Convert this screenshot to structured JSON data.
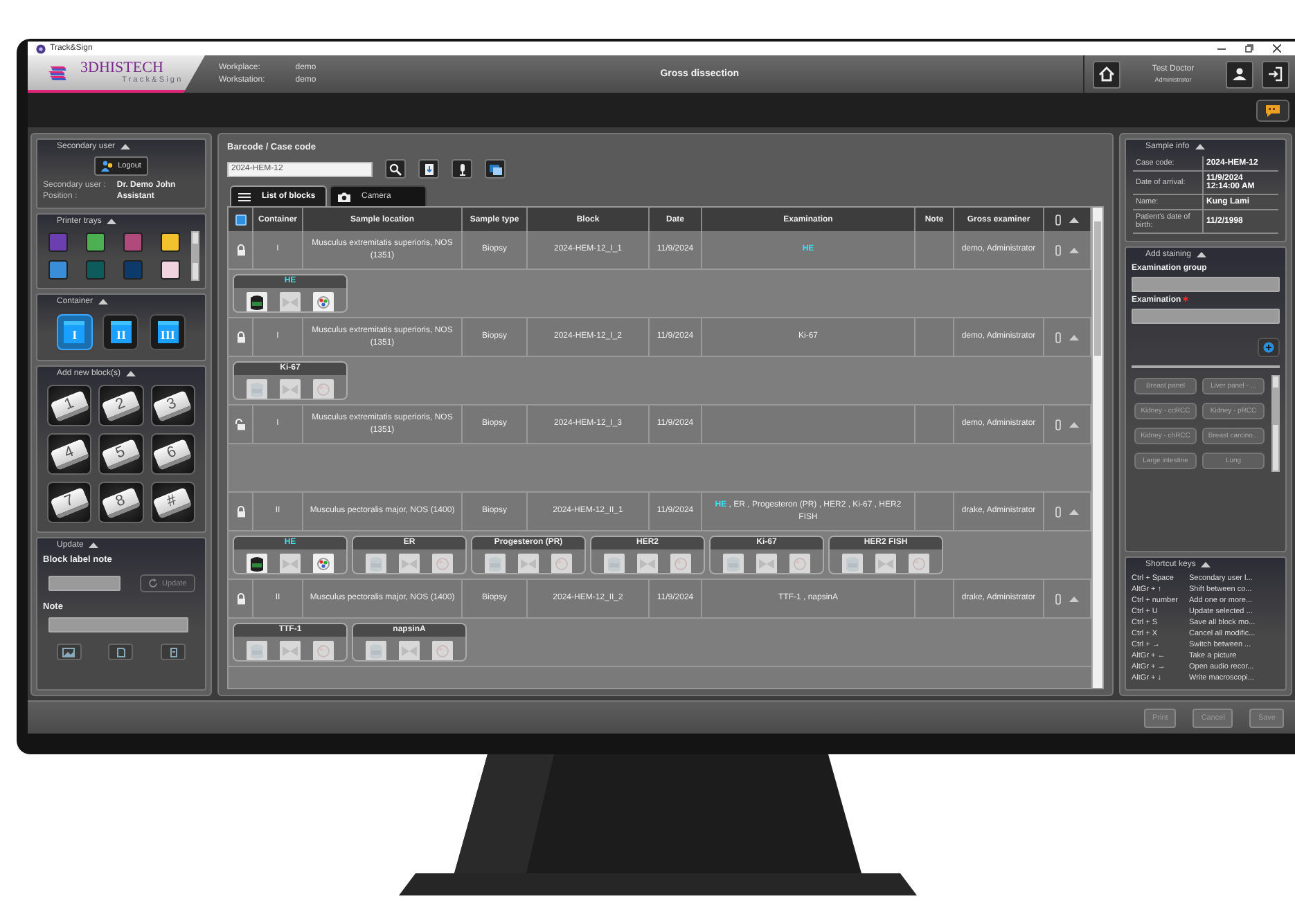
{
  "window": {
    "title": "Track&Sign"
  },
  "header": {
    "logo_name": "3DHISTECH",
    "logo_product": "Track&Sign",
    "info": [
      {
        "label": "Workplace:",
        "value": "demo"
      },
      {
        "label": "Workstation:",
        "value": "demo"
      }
    ],
    "module": "Gross dissection",
    "user": {
      "name": "Test Doctor",
      "role": "Administrator"
    }
  },
  "secondary_user": {
    "title": "Secondary user",
    "logout": "Logout",
    "fields": [
      {
        "label": "Secondary user :",
        "value": "Dr. Demo John"
      },
      {
        "label": "Position :",
        "value": "Assistant"
      }
    ]
  },
  "printer_trays": {
    "title": "Printer trays",
    "trays": [
      {
        "color": "#6b3fb0"
      },
      {
        "color": "#4caf50"
      },
      {
        "color": "#b04a7c"
      },
      {
        "color": "#f2c12e"
      },
      {
        "color": "#3a8ed8"
      },
      {
        "color": "#0e5b5b"
      },
      {
        "color": "#0c3a6b"
      },
      {
        "color": "#f1d3e0"
      }
    ]
  },
  "container": {
    "title": "Container",
    "options": [
      {
        "label": "I",
        "selected": true
      },
      {
        "label": "II",
        "selected": false
      },
      {
        "label": "III",
        "selected": false
      }
    ]
  },
  "add_blocks": {
    "title": "Add new block(s)",
    "keys": [
      "1",
      "2",
      "3",
      "4",
      "5",
      "6",
      "7",
      "8",
      "#"
    ]
  },
  "update": {
    "title": "Update",
    "block_label_note": "Block label note",
    "update_button": "Update",
    "update_disabled": true,
    "note": "Note"
  },
  "search": {
    "label": "Barcode / Case code",
    "value": "2024-HEM-12"
  },
  "tabs": [
    {
      "label": "List of blocks",
      "selected": true,
      "kind": "list"
    },
    {
      "label": "Camera",
      "selected": false,
      "kind": "camera"
    }
  ],
  "table": {
    "select_all_checked": true,
    "columns": [
      "Container",
      "Sample location",
      "Sample type",
      "Block",
      "Date",
      "Examination",
      "Note",
      "Gross examiner"
    ],
    "rows": [
      {
        "locked": true,
        "container": "I",
        "location": "Musculus extremitatis superioris, NOS (1351)",
        "type": "Biopsy",
        "block": "2024-HEM-12_I_1",
        "date": "11/9/2024",
        "examination": [
          {
            "text": "HE",
            "highlighted": true
          }
        ],
        "examiner": "demo, Administrator",
        "stainings": [
          {
            "name": "HE",
            "active": true
          }
        ]
      },
      {
        "locked": true,
        "container": "I",
        "location": "Musculus extremitatis superioris, NOS (1351)",
        "type": "Biopsy",
        "block": "2024-HEM-12_I_2",
        "date": "11/9/2024",
        "examination": [
          {
            "text": "Ki-67",
            "highlighted": false
          }
        ],
        "examiner": "demo, Administrator",
        "stainings": [
          {
            "name": "Ki-67",
            "active": false
          }
        ]
      },
      {
        "locked": false,
        "container": "I",
        "location": "Musculus extremitatis superioris, NOS (1351)",
        "type": "Biopsy",
        "block": "2024-HEM-12_I_3",
        "date": "11/9/2024",
        "examination": [],
        "examiner": "demo, Administrator",
        "stainings": []
      },
      {
        "locked": true,
        "container": "II",
        "location": "Musculus pectoralis major, NOS (1400)",
        "type": "Biopsy",
        "block": "2024-HEM-12_II_1",
        "date": "11/9/2024",
        "examination": [
          {
            "text": "HE",
            "highlighted": true
          },
          {
            "text": " , ER , Progesteron (PR) , HER2 , Ki-67 , HER2 FISH",
            "highlighted": false
          }
        ],
        "examiner": "drake, Administrator",
        "stainings": [
          {
            "name": "HE",
            "active": true
          },
          {
            "name": "ER",
            "active": false
          },
          {
            "name": "Progesteron (PR)",
            "active": false
          },
          {
            "name": "HER2",
            "active": false
          },
          {
            "name": "Ki-67",
            "active": false
          },
          {
            "name": "HER2 FISH",
            "active": false
          }
        ]
      },
      {
        "locked": true,
        "container": "II",
        "location": "Musculus pectoralis major, NOS (1400)",
        "type": "Biopsy",
        "block": "2024-HEM-12_II_2",
        "date": "11/9/2024",
        "examination": [
          {
            "text": "TTF-1 , napsinA",
            "highlighted": false
          }
        ],
        "examiner": "drake, Administrator",
        "stainings": [
          {
            "name": "TTF-1",
            "active": false
          },
          {
            "name": "napsinA",
            "active": false
          }
        ]
      }
    ]
  },
  "sample_info": {
    "title": "Sample info",
    "fields": [
      {
        "label": "Case code:",
        "value": "2024-HEM-12"
      },
      {
        "label": "Date of arrival:",
        "value": "11/9/2024 12:14:00 AM"
      },
      {
        "label": "Name:",
        "value": "Kung Lami"
      },
      {
        "label": "Patient's date of birth:",
        "value": "11/2/1998"
      }
    ]
  },
  "add_staining": {
    "title": "Add staining",
    "group_label": "Examination group",
    "exam_label": "Examination",
    "exam_required": true,
    "panels": [
      "Breast panel",
      "Liver panel - ...",
      "Kidney - ccRCC",
      "Kidney - pRCC",
      "Kidney - chRCC",
      "Breast carcino...",
      "Large intestine",
      "Lung"
    ]
  },
  "shortcuts": {
    "title": "Shortcut keys",
    "items": [
      {
        "keys": "Ctrl + Space",
        "action": "Secondary user l..."
      },
      {
        "keys": "AltGr + ↑",
        "action": "Shift between co..."
      },
      {
        "keys": "Ctrl + number",
        "action": "Add one or more..."
      },
      {
        "keys": "Ctrl + U",
        "action": "Update selected ..."
      },
      {
        "keys": "Ctrl + S",
        "action": "Save all block mo..."
      },
      {
        "keys": "Ctrl + X",
        "action": "Cancel all modific..."
      },
      {
        "keys": "Ctrl + →",
        "action": "Switch between ..."
      },
      {
        "keys": "AltGr + ←",
        "action": "Take a picture"
      },
      {
        "keys": "AltGr + →",
        "action": "Open audio recor..."
      },
      {
        "keys": "AltGr + ↓",
        "action": "Write macroscopi..."
      }
    ]
  },
  "footer": {
    "buttons": [
      {
        "label": "Print",
        "disabled": true
      },
      {
        "label": "Cancel",
        "disabled": true
      },
      {
        "label": "Save",
        "disabled": true
      }
    ]
  }
}
